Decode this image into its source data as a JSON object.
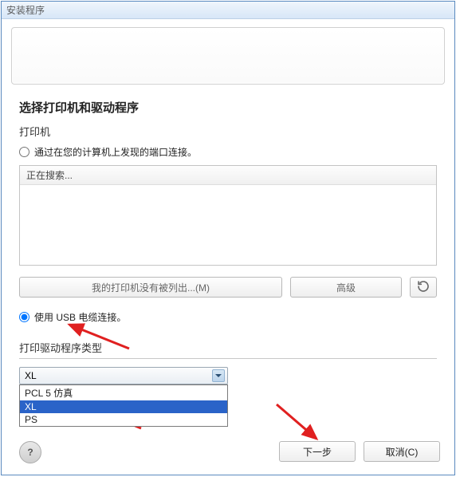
{
  "window": {
    "title": "安装程序"
  },
  "heading": "选择打印机和驱动程序",
  "printer_section_label": "打印机",
  "radio_port": {
    "label": "通过在您的计算机上发现的端口连接。",
    "checked": false
  },
  "searching_header": "正在搜索...",
  "btn_not_listed": "我的打印机没有被列出...(M)",
  "btn_advanced": "高级",
  "radio_usb": {
    "label": "使用 USB 电缆连接。",
    "checked": true
  },
  "driver_type_label": "打印驱动程序类型",
  "select_value": "XL",
  "dropdown": {
    "opt1": "PCL 5 仿真",
    "opt2": "XL",
    "opt3": "PS"
  },
  "footer": {
    "next": "下一步",
    "cancel": "取消(C)"
  },
  "colors": {
    "highlight": "#2a63c8"
  }
}
